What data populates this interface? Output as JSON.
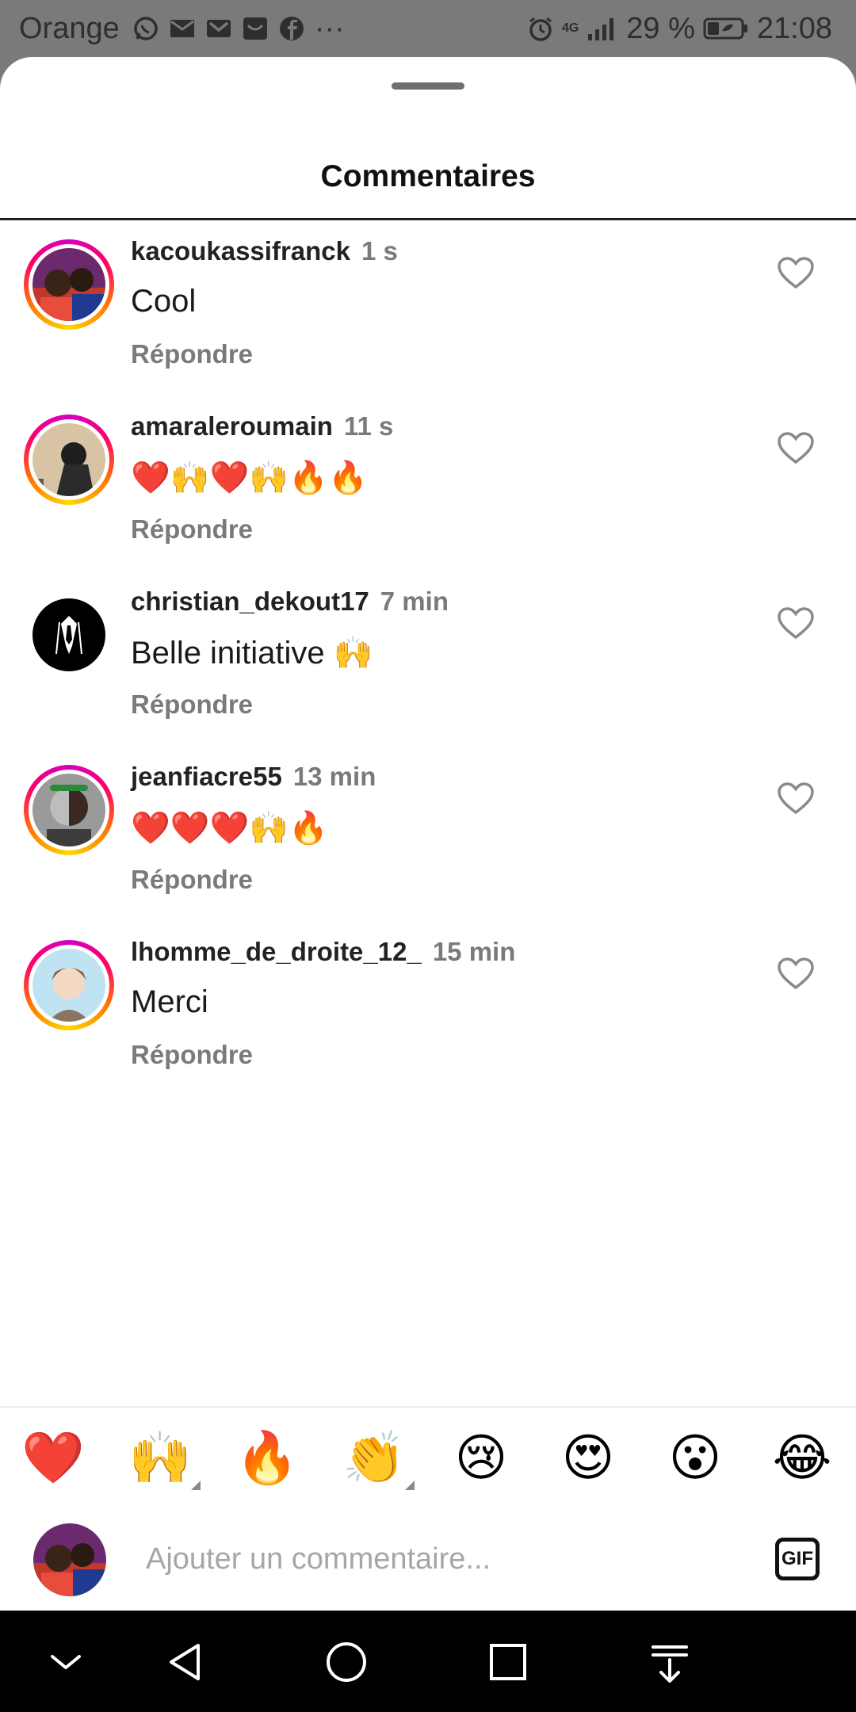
{
  "status_bar": {
    "carrier": "Orange",
    "notification_icons": [
      "whatsapp-icon",
      "mail-icon",
      "gmail-icon",
      "inbox-icon",
      "facebook-icon",
      "more-icon"
    ],
    "more": "···",
    "network": "4G",
    "battery": "29 %",
    "time": "21:08"
  },
  "sheet": {
    "title": "Commentaires"
  },
  "comments": [
    {
      "user": "kacoukassifranck",
      "time": "1 s",
      "text": "Cool",
      "reply": "Répondre"
    },
    {
      "user": "amaraleroumain",
      "time": "11 s",
      "text": "❤️🙌❤️🙌🔥🔥",
      "reply": "Répondre"
    },
    {
      "user": "christian_dekout17",
      "time": "7 min",
      "text": "Belle initiative 🙌",
      "reply": "Répondre"
    },
    {
      "user": "jeanfiacre55",
      "time": "13 min",
      "text": "❤️❤️❤️🙌🔥",
      "reply": "Répondre"
    },
    {
      "user": "lhomme_de_droite_12_",
      "time": "15 min",
      "text": "Merci",
      "reply": "Répondre"
    }
  ],
  "quick_emojis": [
    "❤️",
    "🙌",
    "🔥",
    "👏",
    "😢",
    "😍",
    "😮",
    "😂"
  ],
  "composer": {
    "placeholder": "Ajouter un commentaire...",
    "gif_label": "GIF"
  }
}
